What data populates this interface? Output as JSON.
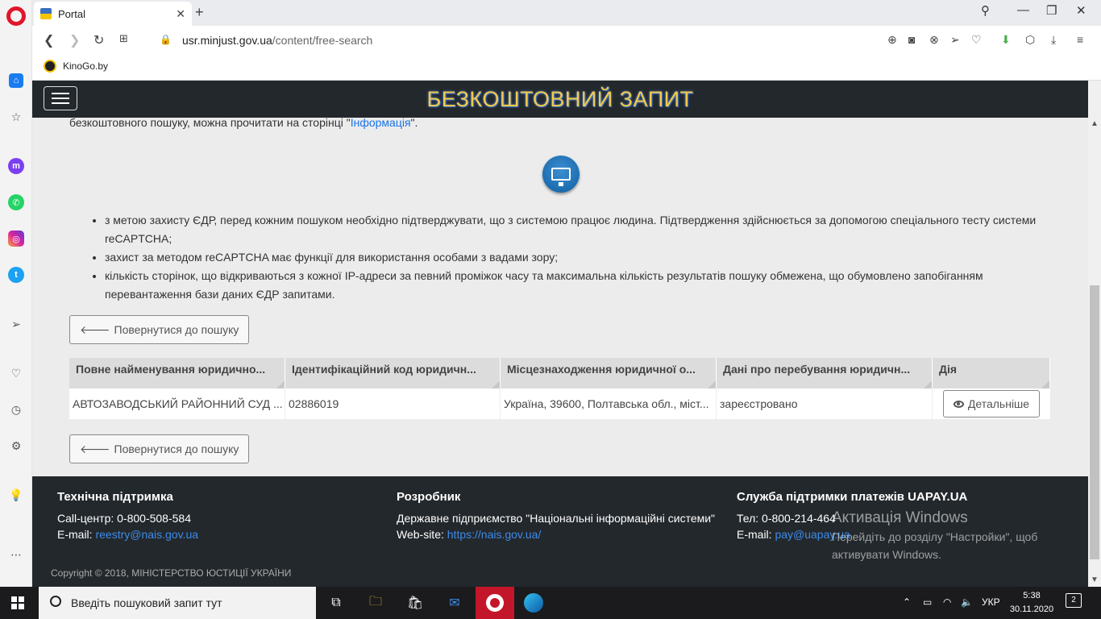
{
  "browser": {
    "tab_title": "Portal",
    "url_domain": "usr.minjust.gov.ua",
    "url_path": "/content/free-search",
    "bookmark": "KinoGo.by"
  },
  "header": {
    "title": "БЕЗКОШТОВНИЙ ЗАПИТ"
  },
  "intro": {
    "text_before": "безкоштовного пошуку, можна прочитати на сторінці \"",
    "link": "Інформація",
    "text_after": "\"."
  },
  "notes": [
    "з метою захисту ЄДР, перед кожним пошуком необхідно підтверджувати, що з системою працює людина. Підтвердження здійснюється за допомогою спеціального тесту системи reCAPTCHA;",
    "захист за методом reCAPTCHA має функції для використання особами з вадами зору;",
    "кількість сторінок, що відкриваються з кожної IP-адреси за певний проміжок часу та максимальна кількість результатів пошуку обмежена, що обумовлено запобіганням перевантаження бази даних ЄДР запитами."
  ],
  "back_button": "Повернутися до пошуку",
  "table": {
    "headers": [
      "Повне найменування юридично...",
      "Ідентифікаційний код юридичн...",
      "Місцезнаходження юридичної о...",
      "Дані про перебування юридичн...",
      "Дія"
    ],
    "row": {
      "name": "АВТОЗАВОДСЬКИЙ РАЙОННИЙ СУД ...",
      "code": "02886019",
      "address": "Україна, 39600, Полтавська обл., міст...",
      "status": "зареєстровано",
      "action": "Детальніше"
    }
  },
  "footer": {
    "support": {
      "title": "Технічна підтримка",
      "call_center": "Call-центр: 0-800-508-584",
      "email_label": "E-mail: ",
      "email": "reestry@nais.gov.ua"
    },
    "developer": {
      "title": "Розробник",
      "org": "Державне підприємство \"Національні інформаційні системи\"",
      "site_label": "Web-site: ",
      "site": "https://nais.gov.ua/"
    },
    "payments": {
      "title": "Служба підтримки платежів UAPAY.UA",
      "phone": "Тел: 0-800-214-464",
      "email_label": "E-mail: ",
      "email": "pay@uapay.ua"
    },
    "copyright": "Copyright © 2018, МІНІСТЕРСТВО ЮСТИЦІЇ УКРАЇНИ"
  },
  "watermark": {
    "line1": "Активація Windows",
    "line2": "Перейдіть до розділу \"Настройки\", щоб",
    "line3": "активувати Windows."
  },
  "taskbar": {
    "search_placeholder": "Введіть пошуковий запит тут",
    "language": "УКР",
    "time": "5:38",
    "date": "30.11.2020",
    "notifications": "2"
  },
  "colors": {
    "navbar_bg": "#23282c",
    "title_color": "#f2c94c",
    "link_color": "#1a73e8",
    "table_header_bg": "#dcdcdc"
  }
}
